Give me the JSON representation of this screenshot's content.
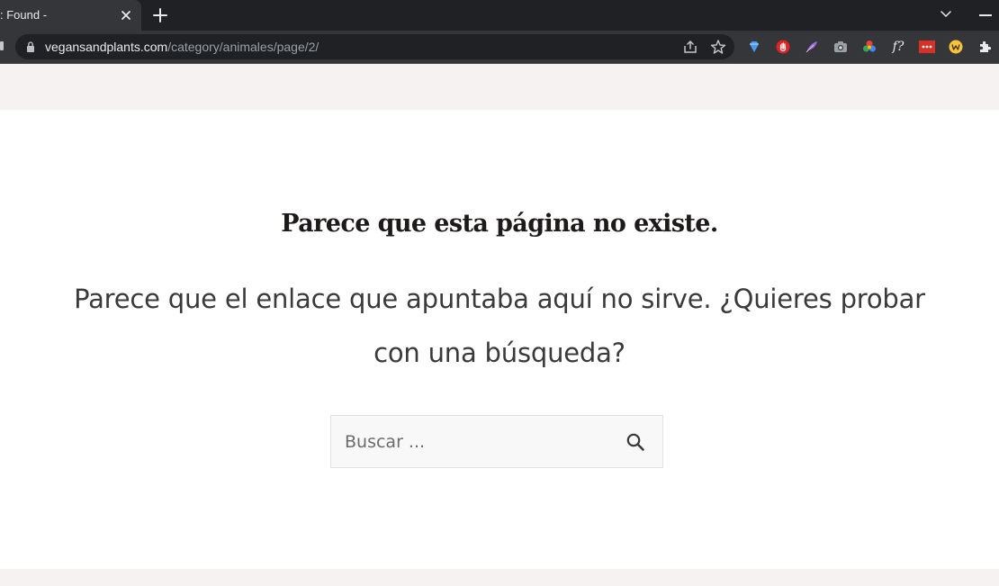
{
  "browser": {
    "tab_title": ": Found -",
    "url_host": "vegansandplants.com",
    "url_path": "/category/animales/page/2/",
    "extension_f_label": "f?"
  },
  "page": {
    "title": "Parece que esta página no existe.",
    "lead": "Parece que el enlace que apuntaba aquí no sirve. ¿Quieres probar con una búsqueda?",
    "search": {
      "placeholder": "Buscar ..."
    }
  }
}
